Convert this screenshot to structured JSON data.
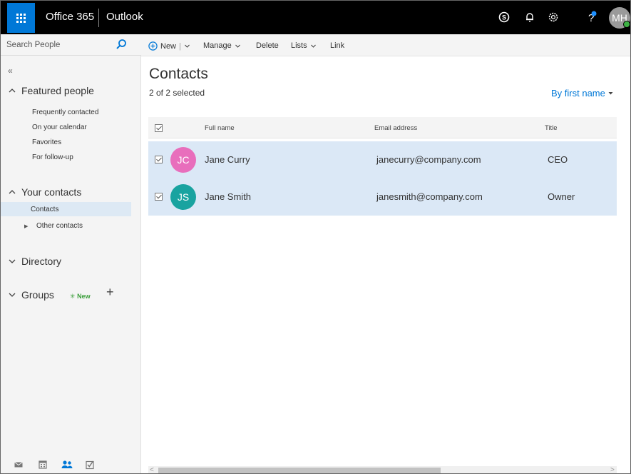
{
  "header": {
    "suite_name": "Office 365",
    "app_name": "Outlook",
    "user_initials": "MH",
    "icons": [
      "waffle-icon",
      "skype-icon",
      "bell-icon",
      "gear-icon",
      "help-icon"
    ],
    "accent_color": "#0078d7"
  },
  "sidebar": {
    "search_placeholder": "Search People",
    "collapse_glyph": "«",
    "featured": {
      "label": "Featured people",
      "items": [
        "Frequently contacted",
        "On your calendar",
        "Favorites",
        "For follow-up"
      ]
    },
    "your_contacts": {
      "label": "Your contacts",
      "items": [
        "Contacts",
        "Other contacts"
      ],
      "selected": "Contacts"
    },
    "directory_label": "Directory",
    "groups": {
      "label": "Groups",
      "badge": "New",
      "badge_glyph": "✳",
      "add_glyph": "+"
    },
    "bottom_nav": [
      "mail-icon",
      "calendar-icon",
      "people-icon",
      "tasks-icon"
    ]
  },
  "commands": {
    "new_label": "New",
    "manage_label": "Manage",
    "delete_label": "Delete",
    "lists_label": "Lists",
    "link_label": "Link"
  },
  "main": {
    "title": "Contacts",
    "selection_text": "2 of 2 selected",
    "sort_label": "By first name",
    "columns": {
      "name": "Full name",
      "email": "Email address",
      "title": "Title"
    },
    "rows": [
      {
        "initials": "JC",
        "name": "Jane Curry",
        "email": "janecurry@company.com",
        "title": "CEO",
        "color": "#e86ebc",
        "checked": true
      },
      {
        "initials": "JS",
        "name": "Jane Smith",
        "email": "janesmith@company.com",
        "title": "Owner",
        "color": "#19a3a0",
        "checked": true
      }
    ]
  }
}
